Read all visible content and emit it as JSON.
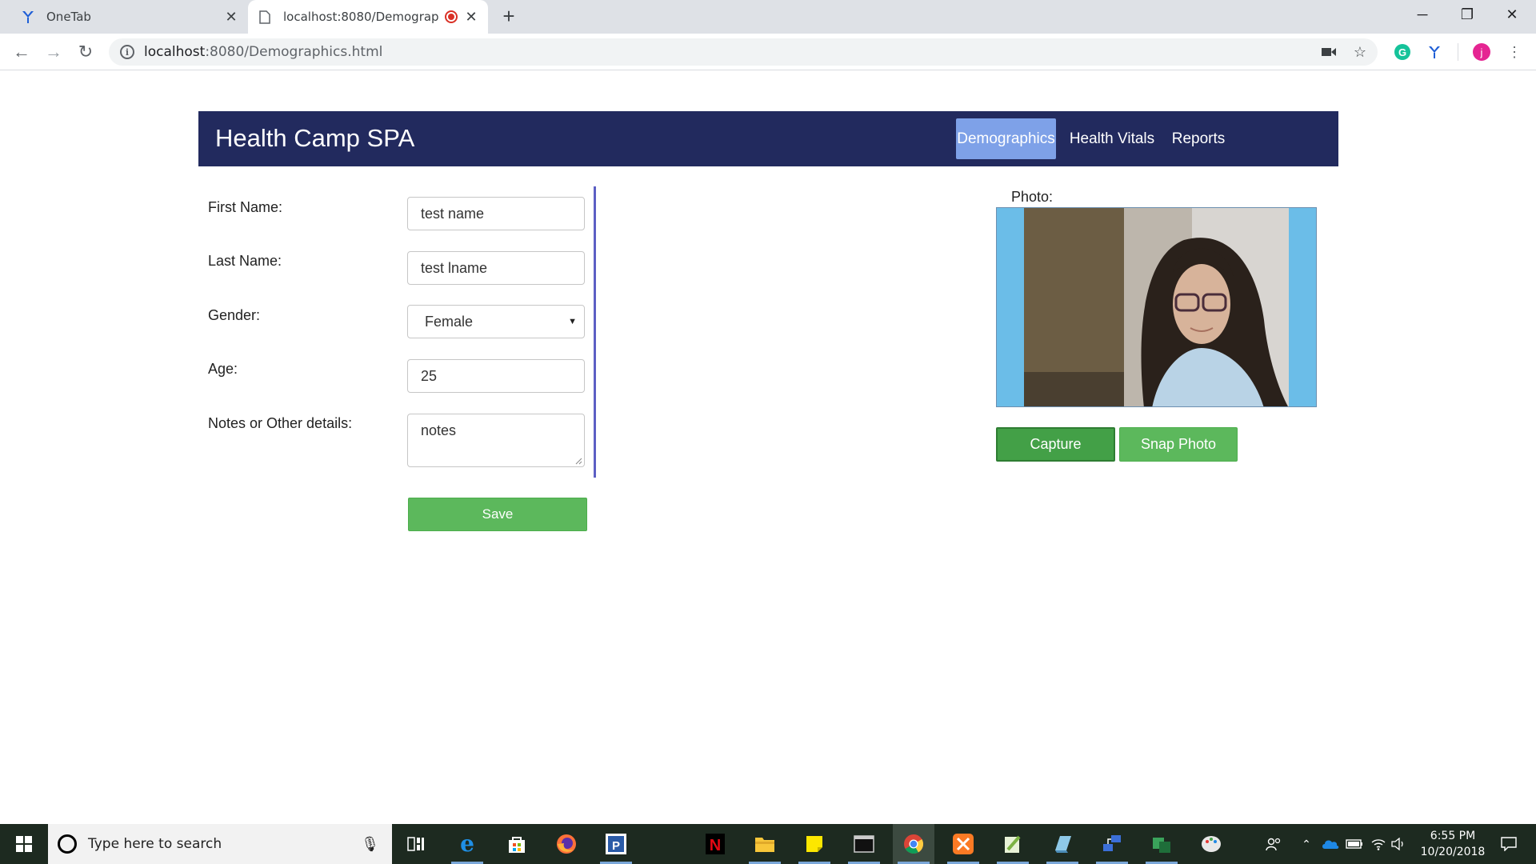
{
  "browser": {
    "tabs": [
      {
        "title": "OneTab"
      },
      {
        "title": "localhost:8080/Demographic"
      }
    ],
    "url_host": "localhost",
    "url_path": ":8080/Demographics.html",
    "profile_initial": "j"
  },
  "app": {
    "title": "Health Camp SPA",
    "nav": [
      {
        "label": "Demographics",
        "active": true
      },
      {
        "label": "Health Vitals",
        "active": false
      },
      {
        "label": "Reports",
        "active": false
      }
    ]
  },
  "form": {
    "first_name": {
      "label": "First Name:",
      "value": "test name"
    },
    "last_name": {
      "label": "Last Name:",
      "value": "test lname"
    },
    "gender": {
      "label": "Gender:",
      "value": "Female"
    },
    "age": {
      "label": "Age:",
      "value": "25"
    },
    "notes": {
      "label": "Notes or Other details:",
      "value": "notes"
    },
    "save_label": "Save"
  },
  "photo": {
    "label": "Photo:",
    "capture_label": "Capture",
    "snap_label": "Snap Photo"
  },
  "taskbar": {
    "search_placeholder": "Type here to search",
    "time": "6:55 PM",
    "date": "10/20/2018"
  },
  "colors": {
    "header_bg": "#222a5e",
    "nav_active": "#7ea1e8",
    "button_green": "#5cb85c",
    "divider": "#5c5fc4",
    "photo_bg": "#6bbde8"
  }
}
